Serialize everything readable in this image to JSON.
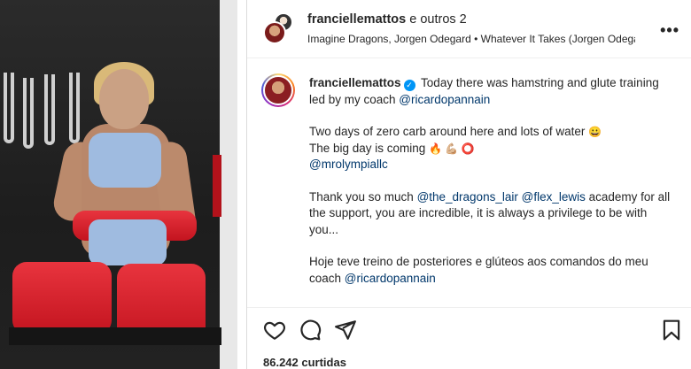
{
  "header": {
    "username": "franciellemattos",
    "coauthors": "e outros 2",
    "music": "Imagine Dragons, Jorgen Odegard • Whatever It Takes (Jorgen Odega...",
    "more_icon": "more-icon"
  },
  "caption": {
    "username": "franciellemattos",
    "line1_text": " Today there was hamstring and glute training led by my coach ",
    "line1_mention": "@ricardopannain",
    "line2_text": "Two days of zero carb around here and lots of water ",
    "line2_emoji": "😀",
    "line3_text": "The big day is coming ",
    "line3_emojis": "🔥 💪🏼 ⭕",
    "line3_mention": "@mrolympiallc",
    "line4_text1": "Thank you so much ",
    "line4_mention1": "@the_dragons_lair",
    "line4_mention2": "@flex_lewis",
    "line4_text2": " academy for all the support, you are incredible, it is always a privilege to be with you...",
    "line5_text": "Hoje teve treino de posteriores e glúteos aos comandos do meu coach ",
    "line5_mention": "@ricardopannain"
  },
  "actions": {
    "like_icon": "heart-icon",
    "comment_icon": "comment-icon",
    "share_icon": "send-icon",
    "save_icon": "bookmark-icon",
    "likes_text": "86.242 curtidas"
  },
  "colors": {
    "mention": "#00376b",
    "verified": "#0095f6",
    "pad_red": "#d11f2a"
  }
}
